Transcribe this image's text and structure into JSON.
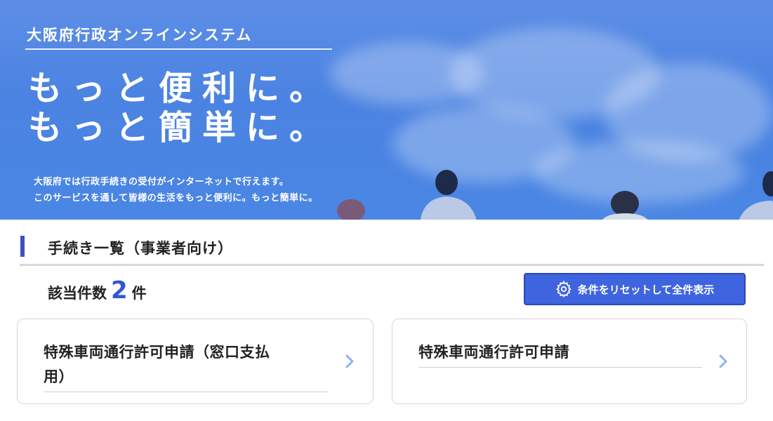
{
  "hero": {
    "system_title": "大阪府行政オンラインシステム",
    "catch_line1": "もっと便利に。",
    "catch_line2": "もっと簡単に。",
    "desc_line1": "大阪府では行政手続きの受付がインターネットで行えます。",
    "desc_line2": "このサービスを通して皆様の生活をもっと便利に。もっと簡単に。"
  },
  "section": {
    "heading": "手続き一覧（事業者向け）"
  },
  "results": {
    "count_label": "該当件数",
    "count": "2",
    "count_unit": "件"
  },
  "reset_button": {
    "label": "条件をリセットして全件表示",
    "icon": "gear-icon"
  },
  "procedures": [
    {
      "title_line1": "特殊車両通行許可申請（窓口支払",
      "title_line2": "用）"
    },
    {
      "title_line1": "特殊車両通行許可申請"
    }
  ],
  "colors": {
    "accent": "#3f51b5",
    "button": "#3f64e0",
    "count": "#2f56d6",
    "chevron": "#8ab4f8",
    "hero_bg": "#4b83e2"
  }
}
